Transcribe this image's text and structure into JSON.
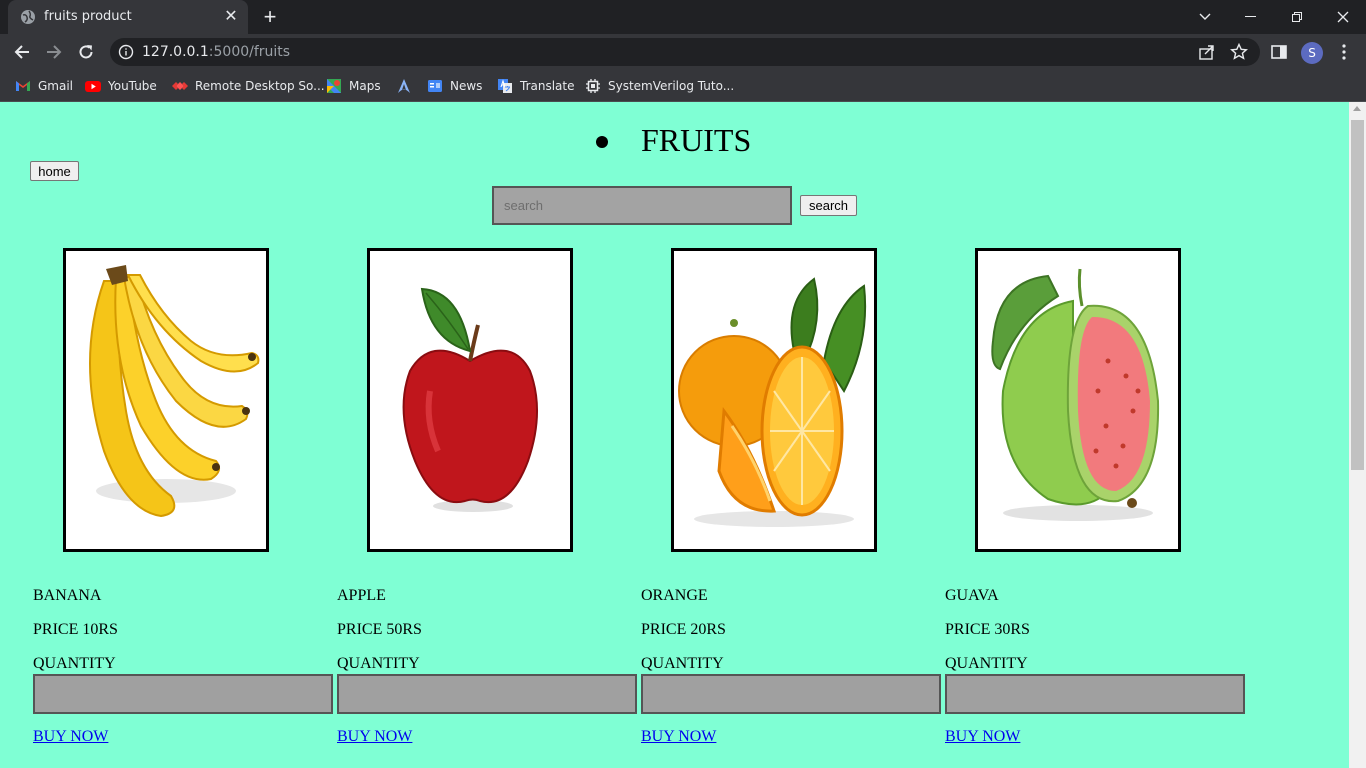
{
  "browser": {
    "tab_title": "fruits product",
    "url_host": "127.0.0.1",
    "url_path": ":5000/fruits",
    "profile_initial": "S",
    "bookmarks": [
      "Gmail",
      "YouTube",
      "Remote Desktop So...",
      "Maps",
      "",
      "News",
      "Translate",
      "SystemVerilog Tuto..."
    ]
  },
  "page": {
    "heading": "FRUITS",
    "home_label": "home",
    "search_placeholder": "search",
    "search_label": "search",
    "background_color": "#7fffd4",
    "products": [
      {
        "name": "BANANA",
        "price": "PRICE 10RS",
        "quantity_label": "QUANTITY",
        "buy_label": "BUY NOW",
        "image": "banana-image"
      },
      {
        "name": "APPLE",
        "price": "PRICE 50RS",
        "quantity_label": "QUANTITY",
        "buy_label": "BUY NOW",
        "image": "apple-image"
      },
      {
        "name": "ORANGE",
        "price": "PRICE 20RS",
        "quantity_label": "QUANTITY",
        "buy_label": "BUY NOW",
        "image": "orange-image"
      },
      {
        "name": "GUAVA",
        "price": "PRICE 30RS",
        "quantity_label": "QUANTITY",
        "buy_label": "BUY NOW",
        "image": "guava-image"
      }
    ]
  }
}
